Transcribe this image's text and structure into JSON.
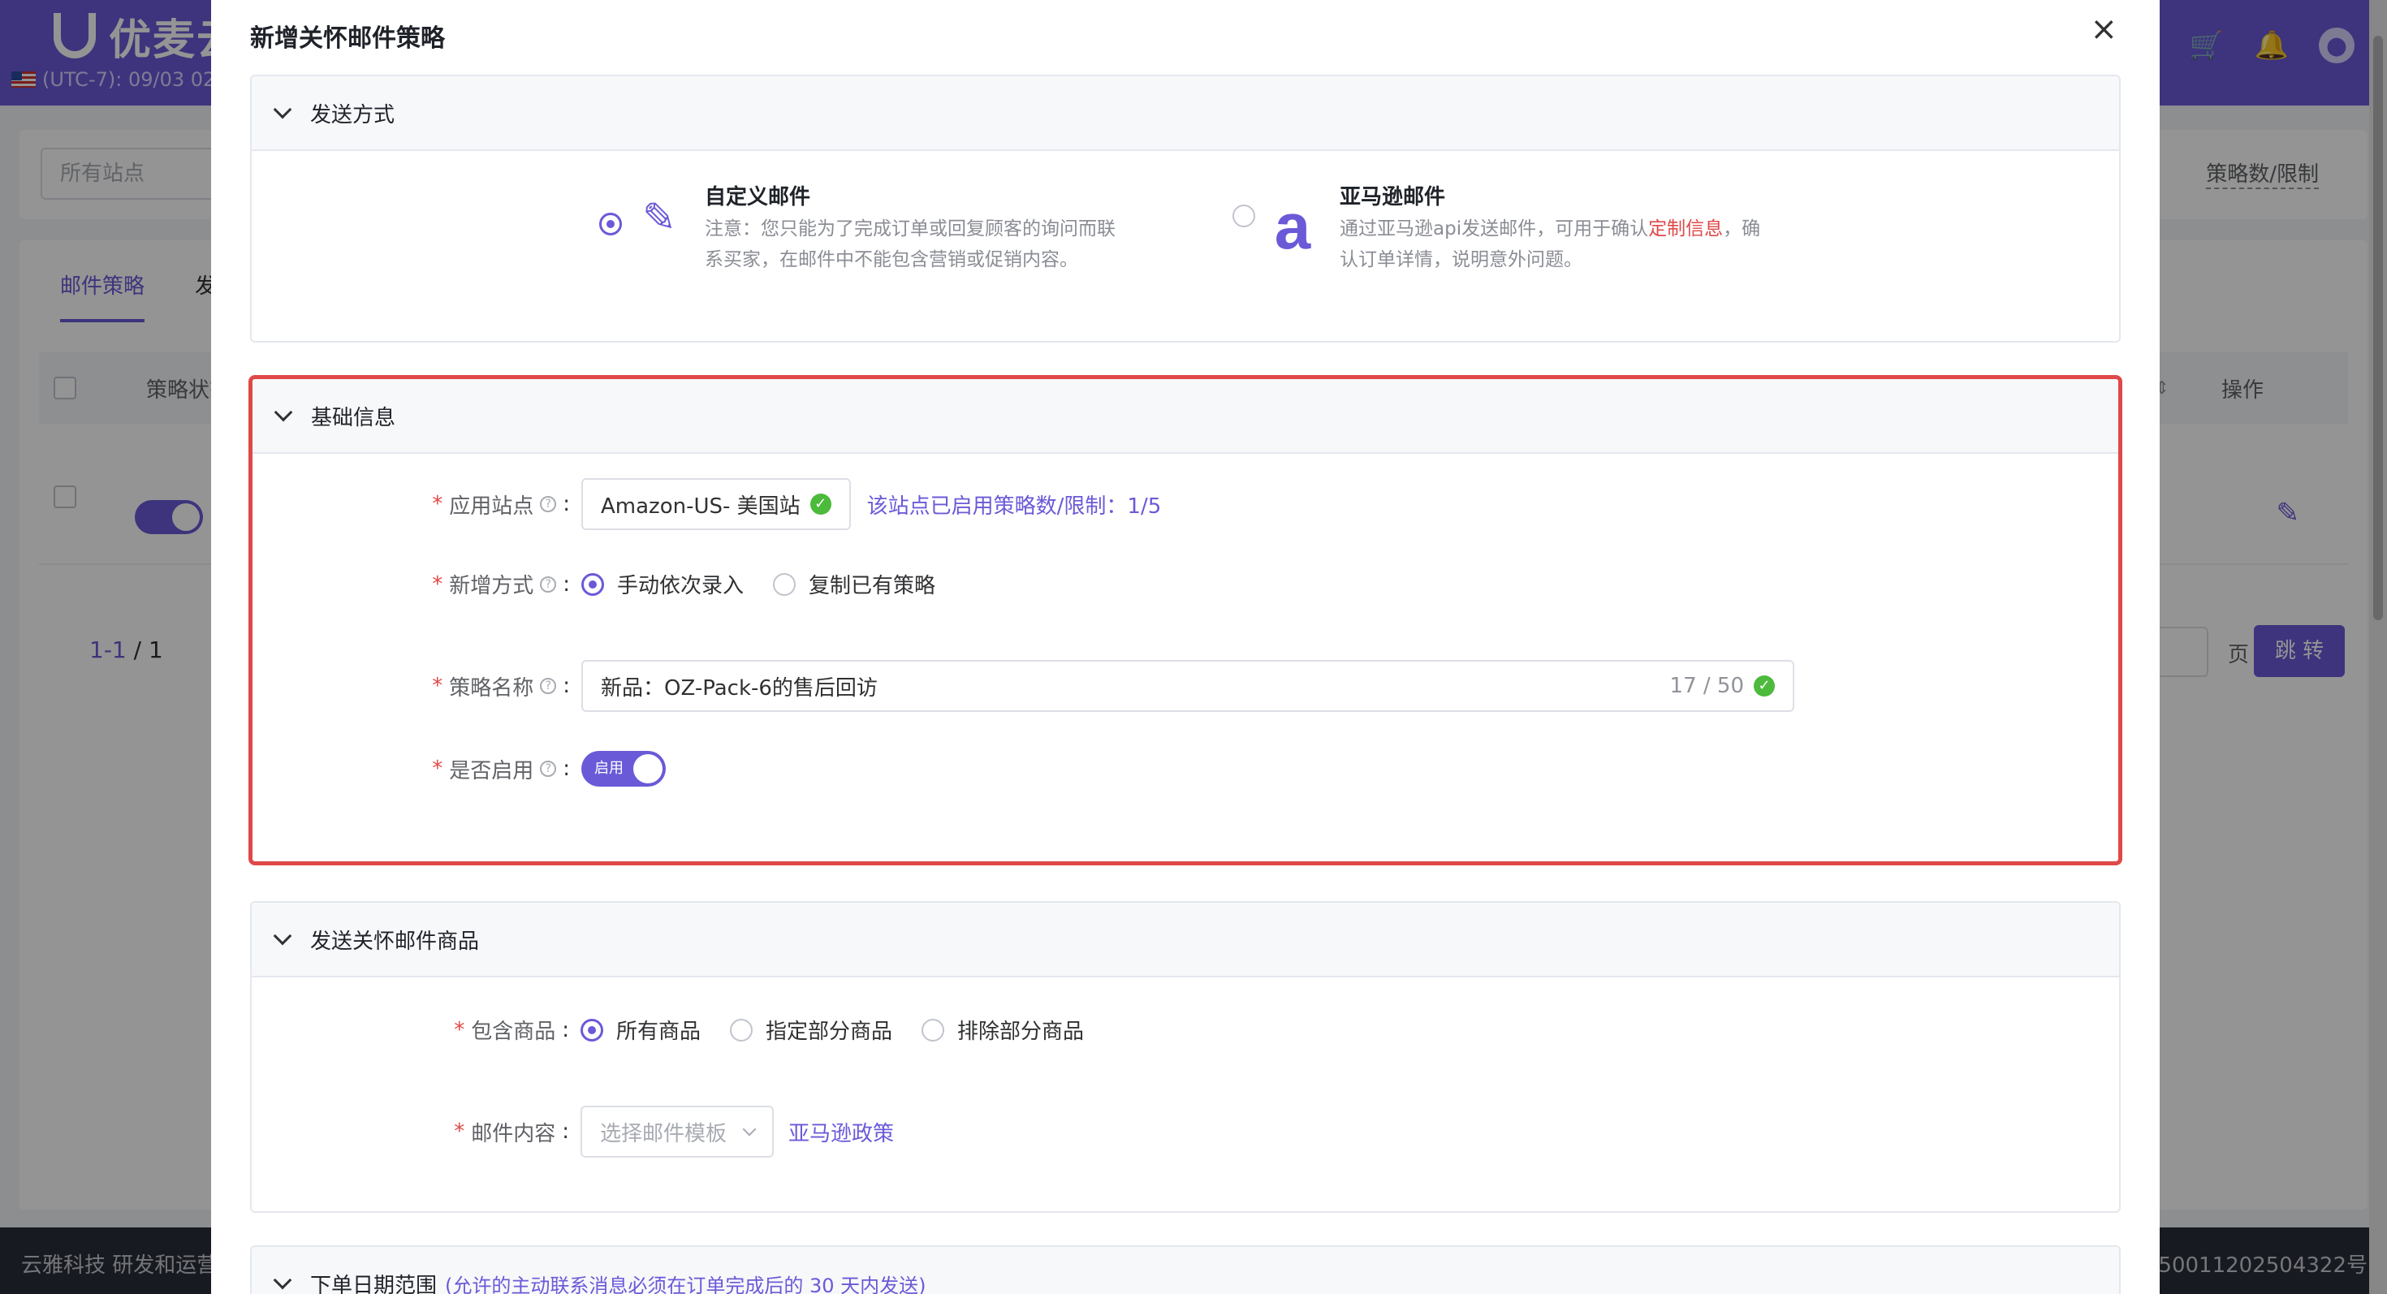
{
  "app": {
    "logo_text": "优麦云",
    "timezone": "(UTC-7): 09/03 02",
    "site_filter_placeholder": "所有站点",
    "right_filter_label": "策略数/限制",
    "tabs": [
      "邮件策略",
      "发"
    ],
    "table_headers": {
      "status": "策略状态",
      "actions": "操作",
      "sort_hint": ")"
    },
    "pager": {
      "range": "1-1",
      "slash_total": "/ 1",
      "page_unit": "页",
      "jump": "跳 转"
    },
    "footer_left": "云雅科技 研发和运营",
    "footer_right": "50011202504322号"
  },
  "modal": {
    "title": "新增关怀邮件策略",
    "close": "×",
    "send_method": {
      "header": "发送方式",
      "options": [
        {
          "title": "自定义邮件",
          "desc": "注意：您只能为了完成订单或回复顾客的询问而联系买家，在邮件中不能包含营销或促销内容。",
          "selected": true,
          "icon": "pen-icon"
        },
        {
          "title": "亚马逊邮件",
          "desc_before": "通过亚马逊api发送邮件，可用于确认",
          "desc_link": "定制信息",
          "desc_after": "，确认订单详情，说明意外问题。",
          "selected": false,
          "icon": "amazon-a-icon"
        }
      ]
    },
    "basic_info": {
      "header": "基础信息",
      "site": {
        "label": "应用站点",
        "value": "Amazon-US- 美国站",
        "limit_text": "该站点已启用策略数/限制：1/5"
      },
      "add_method": {
        "label": "新增方式",
        "options": [
          {
            "label": "手动依次录入",
            "selected": true
          },
          {
            "label": "复制已有策略",
            "selected": false
          }
        ]
      },
      "name": {
        "label": "策略名称",
        "value": "新品：OZ-Pack-6的售后回访",
        "counter": "17 / 50"
      },
      "enabled": {
        "label": "是否启用",
        "switch_text": "启用",
        "on": true
      }
    },
    "products": {
      "header": "发送关怀邮件商品",
      "include": {
        "label": "包含商品",
        "options": [
          {
            "label": "所有商品",
            "selected": true
          },
          {
            "label": "指定部分商品",
            "selected": false
          },
          {
            "label": "排除部分商品",
            "selected": false
          }
        ]
      },
      "content": {
        "label": "邮件内容",
        "placeholder": "选择邮件模板",
        "policy_link": "亚马逊政策"
      }
    },
    "date_range": {
      "header": "下单日期范围",
      "note": "(允许的主动联系消息必须在订单完成后的 30 天内发送)"
    }
  },
  "colors": {
    "accent": "#6a5ad8",
    "highlight_border": "#e04848",
    "success": "#4cba3b"
  }
}
